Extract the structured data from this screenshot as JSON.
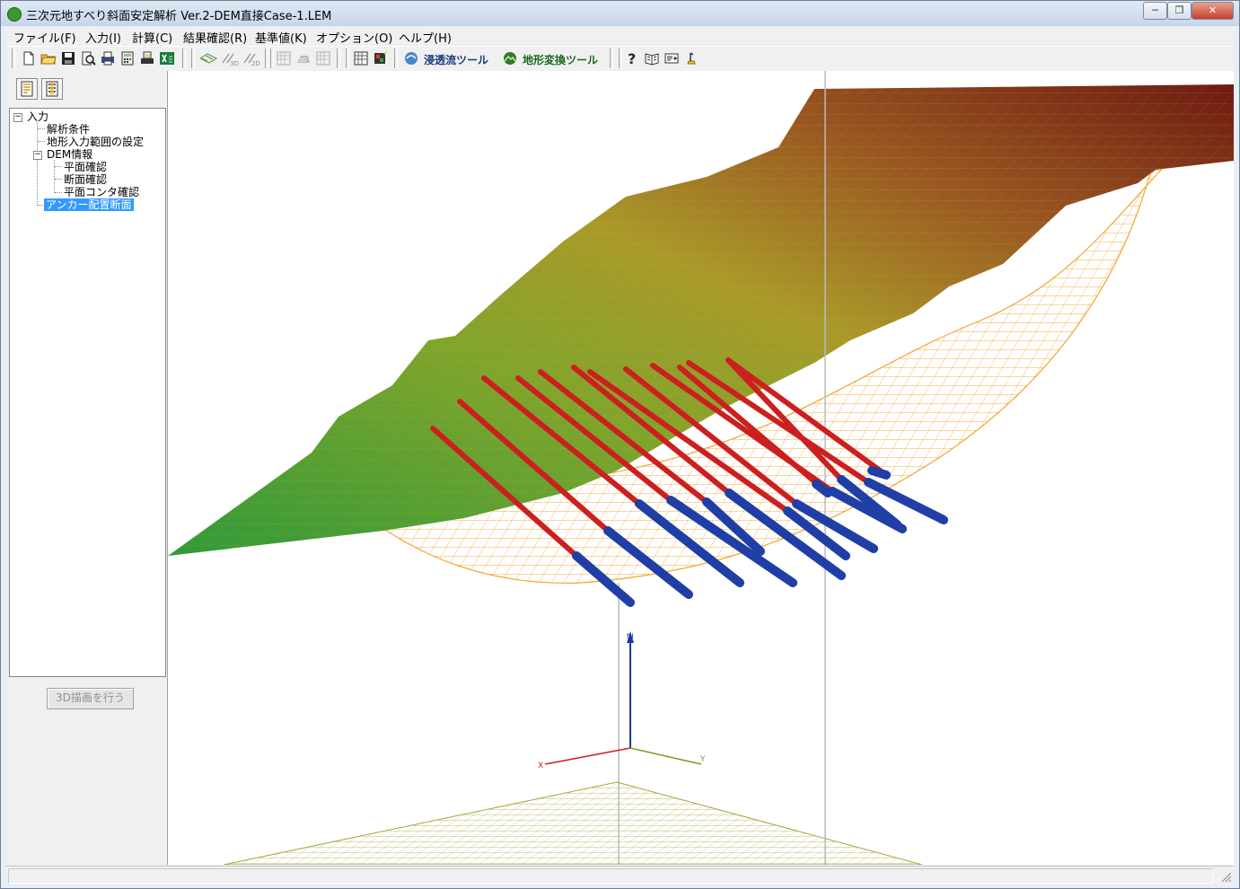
{
  "window": {
    "title": "三次元地すべり斜面安定解析 Ver.2-DEM直接Case-1.LEM",
    "minimize_label": "─",
    "restore_label": "❐",
    "close_label": "✕"
  },
  "menu": {
    "file": "ファイル(F)",
    "input": "入力(I)",
    "calc": "計算(C)",
    "result": "結果確認(R)",
    "standard": "基準値(K)",
    "options": "オプション(O)",
    "help": "ヘルプ(H)"
  },
  "toolbar": {
    "seepage_tool": "浸透流ツール",
    "terrain_tool": "地形変換ツール"
  },
  "tree": {
    "root": "入力",
    "analysis_conditions": "解析条件",
    "terrain_range": "地形入力範囲の設定",
    "dem_info": "DEM情報",
    "plan_check": "平面確認",
    "section_check": "断面確認",
    "contour_check": "平面コンタ確認",
    "anchor_section": "アンカー配置断面"
  },
  "panel": {
    "draw_3d_button": "3D描画を行う"
  },
  "viewport": {
    "axis_x": "X",
    "axis_y": "Y",
    "axis_z": "Z"
  },
  "icons": {
    "new": "new-file-icon",
    "open": "open-folder-icon",
    "save": "save-icon",
    "preview": "print-preview-icon",
    "print": "print-icon",
    "calc": "calculator-icon",
    "export": "export-icon",
    "excel": "excel-icon",
    "help": "help-icon"
  },
  "colors": {
    "title_bar": "#c6d6ea",
    "tree_selection": "#3399ff",
    "slope_low": "#3e9a3a",
    "slope_high": "#6e1a12",
    "slip_mesh": "#f2a531",
    "anchor_free": "#cc1f1f",
    "anchor_fixed": "#1f3fa6",
    "axis_x": "#d22020",
    "axis_y": "#7aa020",
    "axis_z": "#1a3a9a"
  }
}
